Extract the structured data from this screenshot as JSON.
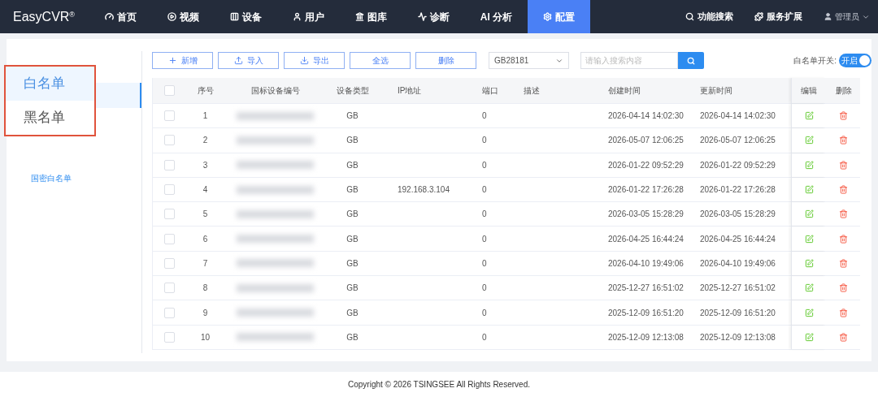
{
  "nav": {
    "brand": "EasyCVR",
    "brand_mark": "®",
    "items": [
      {
        "label": "首页",
        "selected": false
      },
      {
        "label": "视频",
        "selected": false
      },
      {
        "label": "设备",
        "selected": false
      },
      {
        "label": "用户",
        "selected": false
      },
      {
        "label": "图库",
        "selected": false
      },
      {
        "label": "诊断",
        "selected": false
      },
      {
        "label": "AI 分析",
        "selected": false
      },
      {
        "label": "配置",
        "selected": true
      }
    ],
    "right": [
      {
        "label": "功能搜索"
      },
      {
        "label": "服务扩展"
      }
    ],
    "user": "管理员"
  },
  "sidebar": {
    "items": [
      {
        "label": "国密白名单"
      }
    ]
  },
  "callout": {
    "items": [
      {
        "label": "白名单",
        "selected": true
      },
      {
        "label": "黑名单",
        "selected": false
      }
    ]
  },
  "toolbar": {
    "buttons": [
      "新增",
      "导入",
      "导出",
      "全选",
      "删除"
    ],
    "protocol": "GB28181",
    "search": {
      "placeholder": "请输入搜索内容"
    },
    "switch": {
      "label": "白名单开关:",
      "text": "开启",
      "on": true
    }
  },
  "table": {
    "columns": [
      "序号",
      "国标设备编号",
      "设备类型",
      "IP地址",
      "端口",
      "描述",
      "创建时间",
      "更新时间",
      "编辑",
      "删除"
    ],
    "all_checked": false,
    "rows": [
      {
        "index": "1",
        "type": "GB",
        "ip": "",
        "port": "0",
        "created": "2026-04-14 14:02:30",
        "updated": "2026-04-14 14:02:30",
        "checked": false
      },
      {
        "index": "2",
        "type": "GB",
        "ip": "",
        "port": "0",
        "created": "2026-05-07 12:06:25",
        "updated": "2026-05-07 12:06:25",
        "checked": false
      },
      {
        "index": "3",
        "type": "GB",
        "ip": "",
        "port": "0",
        "created": "2026-01-22 09:52:29",
        "updated": "2026-01-22 09:52:29",
        "checked": false
      },
      {
        "index": "4",
        "type": "GB",
        "ip": "192.168.3.104",
        "port": "0",
        "created": "2026-01-22 17:26:28",
        "updated": "2026-01-22 17:26:28",
        "checked": false
      },
      {
        "index": "5",
        "type": "GB",
        "ip": "",
        "port": "0",
        "created": "2026-03-05 15:28:29",
        "updated": "2026-03-05 15:28:29",
        "checked": false
      },
      {
        "index": "6",
        "type": "GB",
        "ip": "",
        "port": "0",
        "created": "2026-04-25 16:44:24",
        "updated": "2026-04-25 16:44:24",
        "checked": false
      },
      {
        "index": "7",
        "type": "GB",
        "ip": "",
        "port": "0",
        "created": "2026-04-10 19:49:06",
        "updated": "2026-04-10 19:49:06",
        "checked": false
      },
      {
        "index": "8",
        "type": "GB",
        "ip": "",
        "port": "0",
        "created": "2025-12-27 16:51:02",
        "updated": "2025-12-27 16:51:02",
        "checked": false
      },
      {
        "index": "9",
        "type": "GB",
        "ip": "",
        "port": "0",
        "created": "2025-12-09 16:51:20",
        "updated": "2025-12-09 16:51:20",
        "checked": false
      },
      {
        "index": "10",
        "type": "GB",
        "ip": "",
        "port": "0",
        "created": "2025-12-09 12:13:08",
        "updated": "2025-12-09 12:13:08",
        "checked": false
      }
    ]
  },
  "footer": "Copyright © 2026 TSINGSEE All Rights Reserved."
}
